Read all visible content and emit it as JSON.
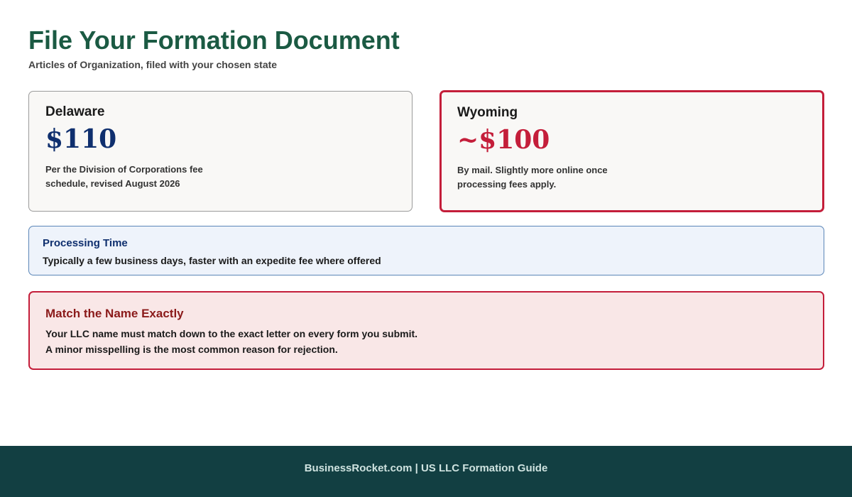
{
  "header": {
    "title": "File Your Formation Document",
    "subtitle": "Articles of Organization, filed with your chosen state"
  },
  "states": [
    {
      "name": "Delaware",
      "price": "$110",
      "note": "Per the Division of Corporations fee schedule, revised August 2026"
    },
    {
      "name": "Wyoming",
      "price": "~$100",
      "note": "By mail. Slightly more online once processing fees apply."
    }
  ],
  "processing": {
    "title": "Processing Time",
    "text": "Typically a few business days, faster with an expedite fee where offered"
  },
  "warning": {
    "title": "Match the Name Exactly",
    "line1": "Your LLC name must match down to the exact letter on every form you submit.",
    "line2": "A minor misspelling is the most common reason for rejection."
  },
  "footer": {
    "text": "BusinessRocket.com | US LLC Formation Guide"
  },
  "colors": {
    "title_green": "#1b5a43",
    "delaware_price": "#0f2f6e",
    "wyoming_accent": "#c41e3a",
    "footer_bg": "#123f42"
  }
}
